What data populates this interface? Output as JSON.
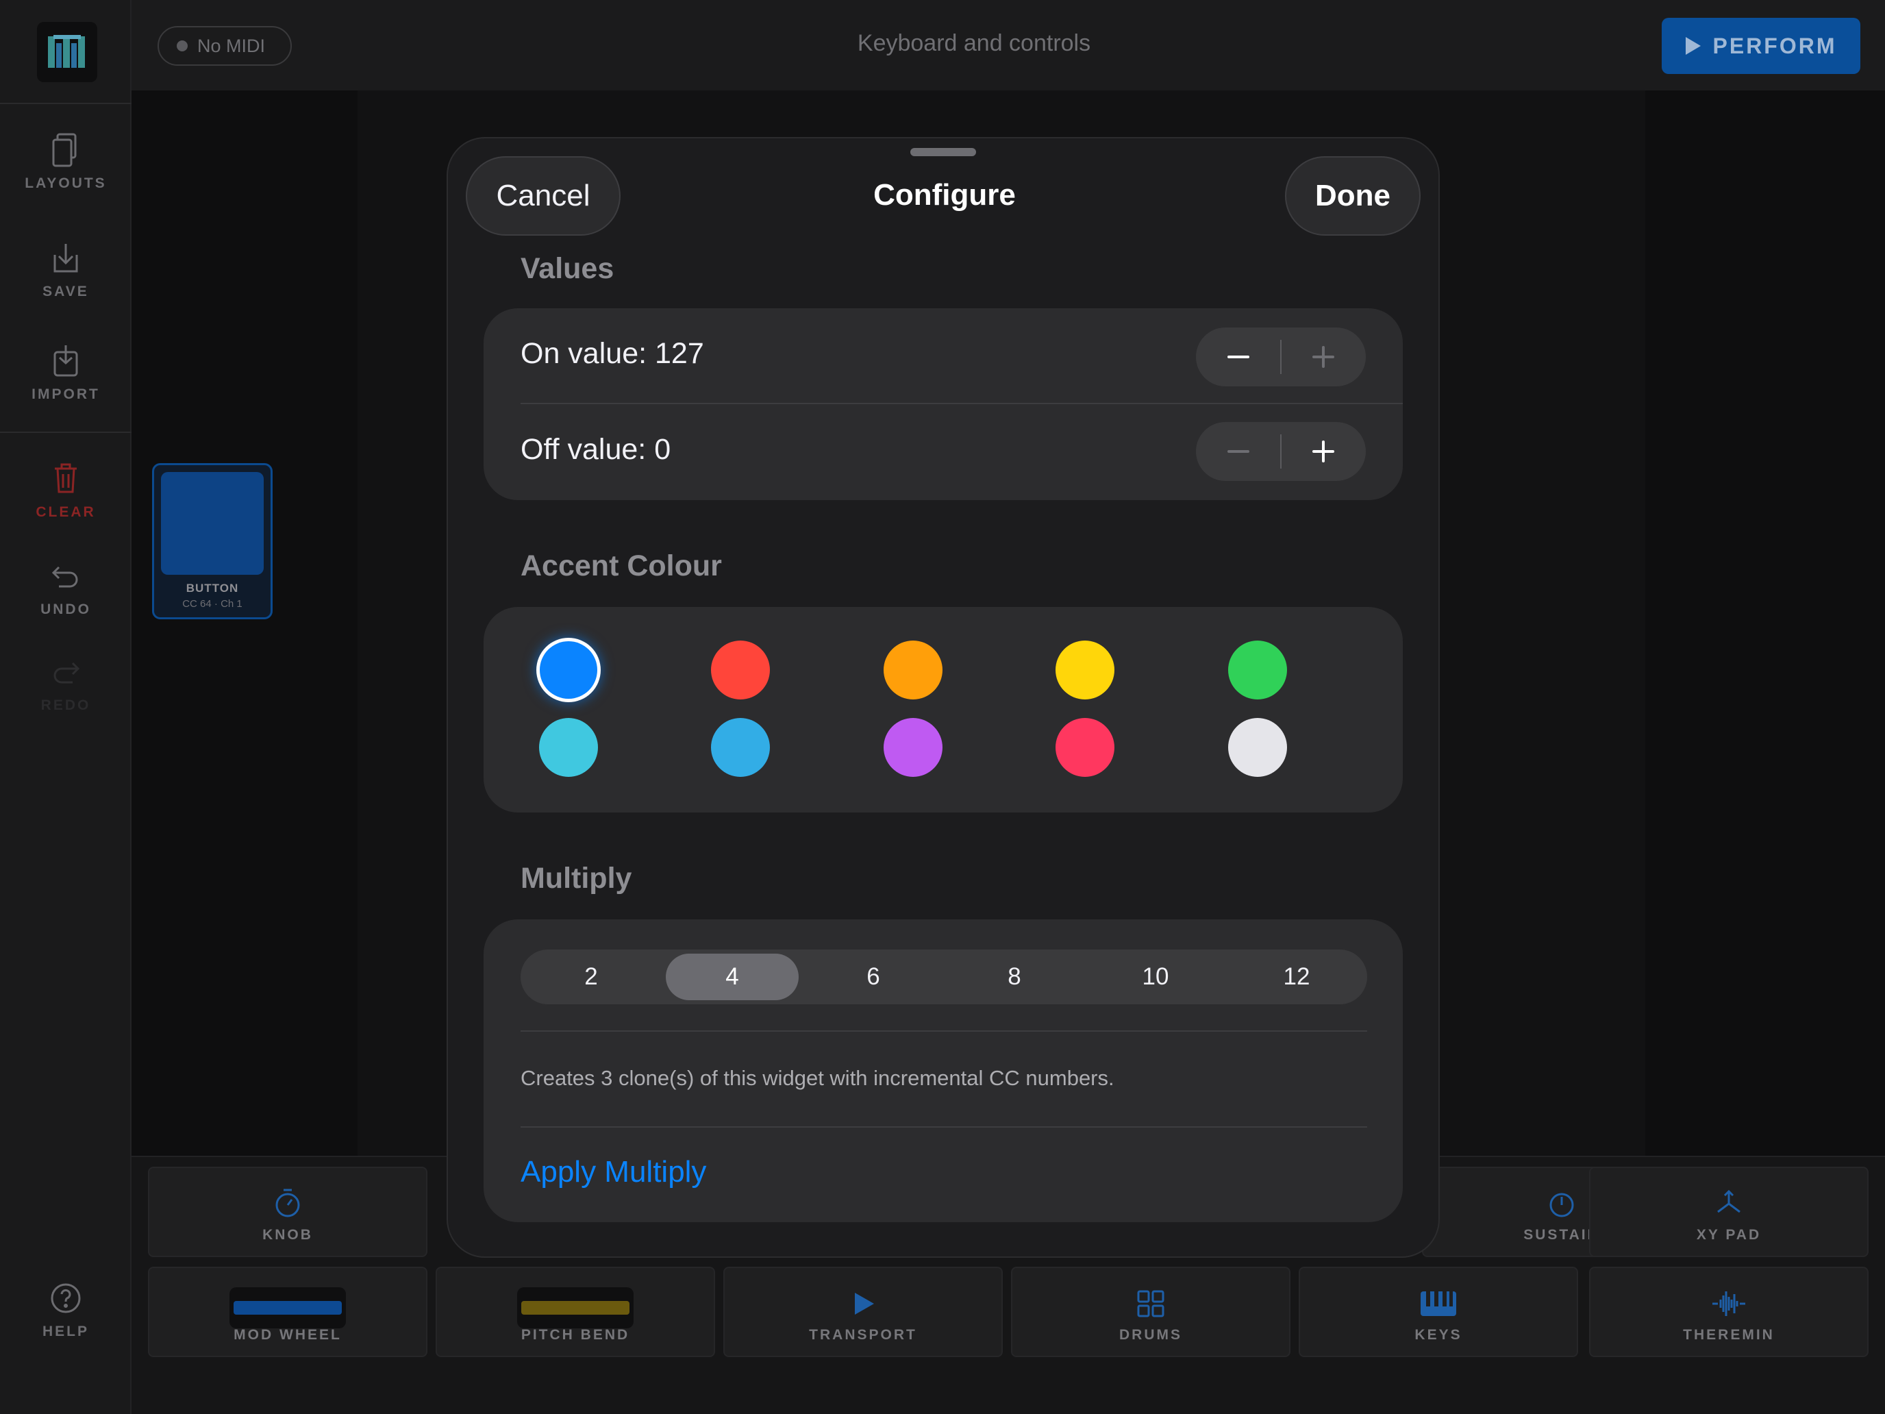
{
  "app": {
    "top_title": "Keyboard and controls",
    "midi_status": "No MIDI",
    "perform_label": "PERFORM"
  },
  "sidebar": {
    "items": [
      {
        "label": "LAYOUTS",
        "icon": "layouts-icon"
      },
      {
        "label": "SAVE",
        "icon": "save-icon"
      },
      {
        "label": "IMPORT",
        "icon": "import-icon"
      },
      {
        "label": "CLEAR",
        "icon": "trash-icon",
        "color": "#8b2424"
      },
      {
        "label": "UNDO",
        "icon": "undo-icon"
      },
      {
        "label": "REDO",
        "icon": "redo-icon"
      },
      {
        "label": "HELP",
        "icon": "help-icon"
      }
    ]
  },
  "widget": {
    "label": "BUTTON",
    "sub": "CC 64 · Ch 1"
  },
  "palette": {
    "tiles": [
      {
        "label": "KNOB",
        "icon": "knob-icon"
      },
      {
        "label": "SUSTAIN",
        "icon": "sustain-icon"
      },
      {
        "label": "XY PAD",
        "icon": "xy-pad-icon"
      },
      {
        "label": "MOD WHEEL",
        "icon": "mod-wheel-icon"
      },
      {
        "label": "PITCH BEND",
        "icon": "pitch-bend-icon"
      },
      {
        "label": "TRANSPORT",
        "icon": "play-icon"
      },
      {
        "label": "DRUMS",
        "icon": "grid-icon"
      },
      {
        "label": "KEYS",
        "icon": "piano-icon"
      },
      {
        "label": "THEREMIN",
        "icon": "waveform-icon"
      }
    ]
  },
  "modal": {
    "title": "Configure",
    "cancel_label": "Cancel",
    "done_label": "Done",
    "values": {
      "section_title": "Values",
      "on_value_label": "On value: 127",
      "off_value_label": "Off value: 0",
      "on_minus_enabled": true,
      "on_plus_enabled": false,
      "off_minus_enabled": false,
      "off_plus_enabled": true
    },
    "accent": {
      "section_title": "Accent Colour",
      "selected_index": 0,
      "colors": [
        "#0a84ff",
        "#ff453a",
        "#ff9f0a",
        "#ffd60a",
        "#30d158",
        "#40c8e0",
        "#32ade6",
        "#bf5af2",
        "#ff375f",
        "#e5e5ea"
      ]
    },
    "multiply": {
      "section_title": "Multiply",
      "options": [
        "2",
        "4",
        "6",
        "8",
        "10",
        "12"
      ],
      "selected": "4",
      "note": "Creates 3 clone(s) of this widget with incremental CC numbers.",
      "apply_label": "Apply Multiply"
    }
  }
}
